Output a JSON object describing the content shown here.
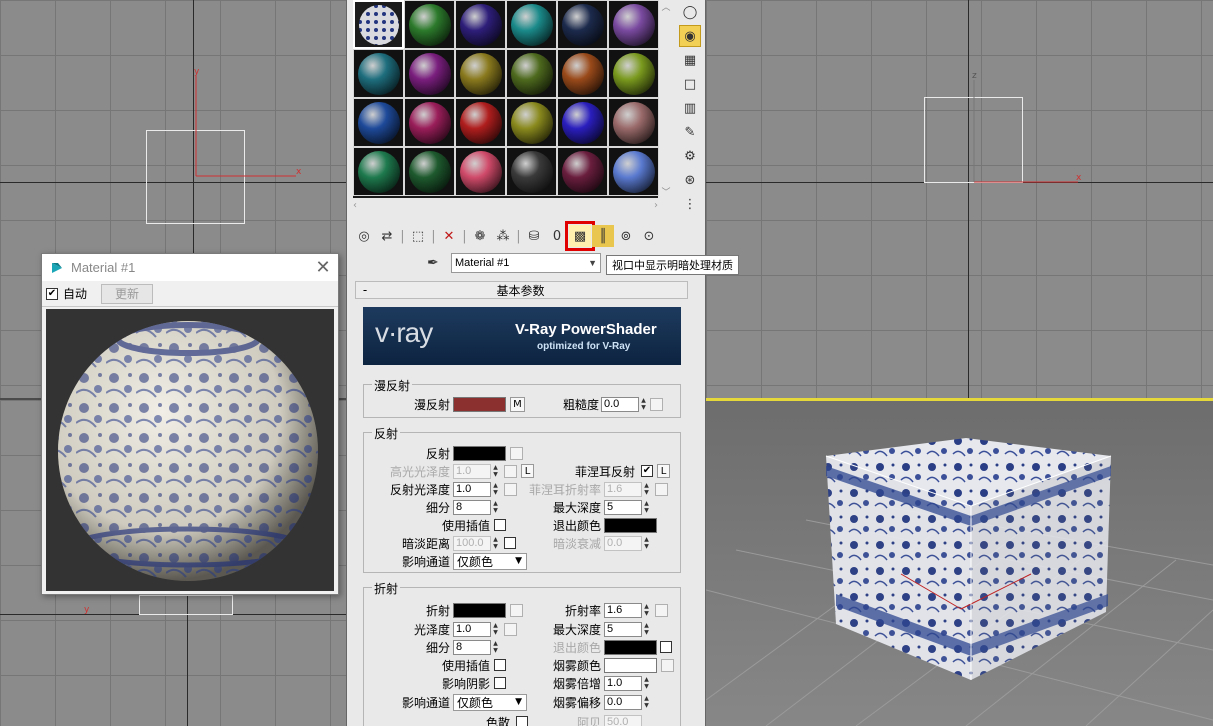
{
  "viewports": {
    "top_left": {
      "axis_x": "x",
      "axis_y": "y"
    },
    "top_right": {
      "axis_x": "x",
      "axis_z": "z"
    },
    "bottom_left": {
      "axis_y": "y"
    }
  },
  "material_window": {
    "title": "Material #1",
    "auto_label": "自动",
    "auto_checked": true,
    "update_label": "更新"
  },
  "slot_colors": [
    "#2c7a2c",
    "#2e1e7a",
    "#1b8a8a",
    "#1c2a4c",
    "#7a4aa0",
    "#1e6e7e",
    "#7a1e7e",
    "#8a7a1e",
    "#4e6a1e",
    "#9a4a1a",
    "#7a9a1e",
    "#1e4a9a",
    "#9a1e5a",
    "#b01e1e",
    "#8a8a1e",
    "#2a1ebe",
    "#9a6a6a",
    "#1e7a4e",
    "#1e5a2e",
    "#d04a6a",
    "#3a3a3a",
    "#6a1e3e",
    "#5a7ad0"
  ],
  "toolbar": {
    "tooltip": "视口中显示明暗处理材质"
  },
  "material_name": "Material #1",
  "rollout": {
    "title": "基本参数",
    "toggle": "-",
    "banner_logo": "v·ray",
    "banner_title": "V-Ray PowerShader",
    "banner_sub": "optimized for V-Ray"
  },
  "diffuse": {
    "group": "漫反射",
    "label": "漫反射",
    "color": "#8c2f2f",
    "map_btn": "M",
    "roughness_label": "粗糙度",
    "roughness": "0.0"
  },
  "reflection": {
    "group": "反射",
    "reflect_label": "反射",
    "reflect_color": "#000000",
    "hilight_label": "高光光泽度",
    "hilight": "1.0",
    "lock": "L",
    "fresnel_label": "菲涅耳反射",
    "fresnel_checked": true,
    "fresnel_lock": "L",
    "gloss_label": "反射光泽度",
    "gloss": "1.0",
    "fresnel_ior_label": "菲涅耳折射率",
    "fresnel_ior": "1.6",
    "subdivs_label": "细分",
    "subdivs": "8",
    "max_depth_label": "最大深度",
    "max_depth": "5",
    "interp_label": "使用插值",
    "exit_color_label": "退出颜色",
    "exit_color": "#000000",
    "dim_dist_label": "暗淡距离",
    "dim_dist": "100.0",
    "dim_falloff_label": "暗淡衰减",
    "dim_falloff": "0.0",
    "affect_label": "影响通道",
    "affect_value": "仅颜色"
  },
  "refraction": {
    "group": "折射",
    "refract_label": "折射",
    "refract_color": "#000000",
    "ior_label": "折射率",
    "ior": "1.6",
    "gloss_label": "光泽度",
    "gloss": "1.0",
    "max_depth_label": "最大深度",
    "max_depth": "5",
    "subdivs_label": "细分",
    "subdivs": "8",
    "exit_color_label": "退出颜色",
    "exit_color": "#000000",
    "interp_label": "使用插值",
    "fog_color_label": "烟雾颜色",
    "fog_color": "#ffffff",
    "shadows_label": "影响阴影",
    "fog_mult_label": "烟雾倍增",
    "fog_mult": "1.0",
    "affect_label": "影响通道",
    "affect_value": "仅颜色",
    "fog_bias_label": "烟雾偏移",
    "fog_bias": "0.0",
    "dispersion_label": "色散",
    "abbe_label": "阿贝",
    "abbe": "50.0"
  }
}
